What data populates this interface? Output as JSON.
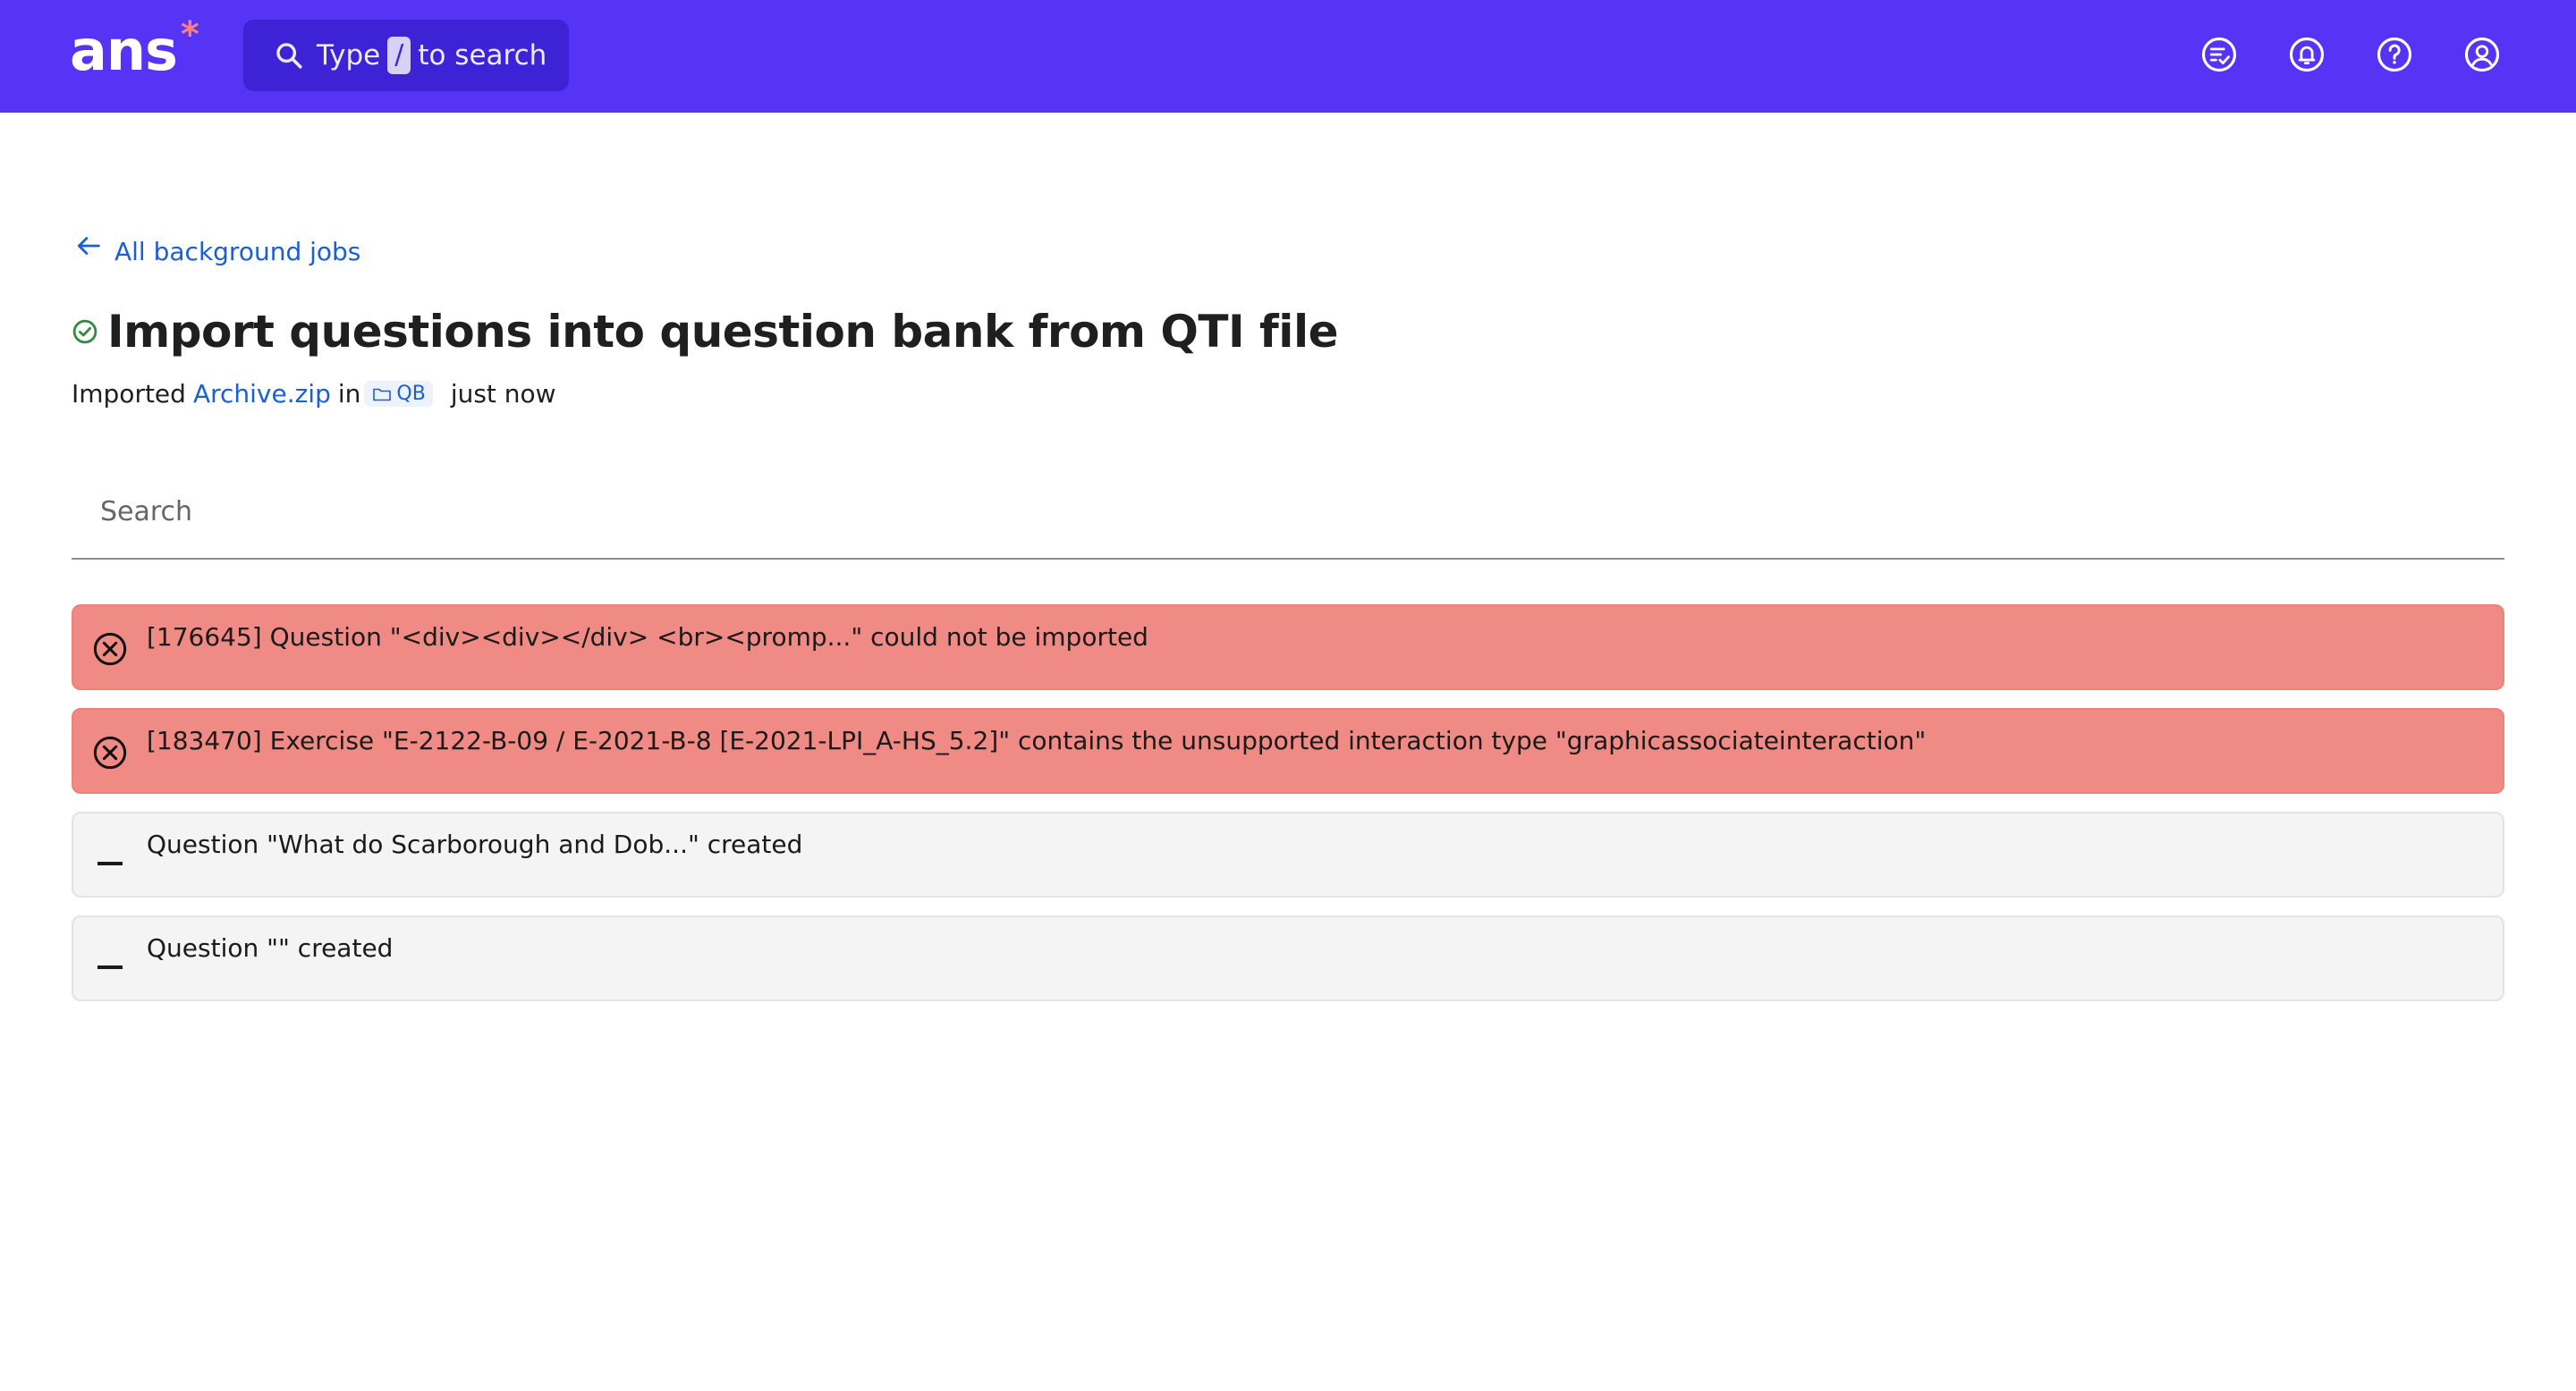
{
  "header": {
    "logo_text": "ans",
    "logo_mark": "*",
    "search_prefix": "Type",
    "search_key": "/",
    "search_suffix": "to search",
    "icons": [
      "tasks-icon",
      "notifications-icon",
      "help-icon",
      "account-icon"
    ],
    "brand_color": "#5534f6"
  },
  "nav": {
    "back_label": "All background jobs"
  },
  "page": {
    "title": "Import questions into question bank from QTI file",
    "status": "success",
    "imported_label": "Imported",
    "file_name": "Archive.zip",
    "in_label": "in",
    "folder_name": "QB",
    "time": "just now"
  },
  "search": {
    "placeholder": "Search",
    "value": ""
  },
  "results": [
    {
      "type": "error",
      "icon": "error-circle-icon",
      "message": "[176645] Question \"<div><div></div> <br><promp...\" could not be imported"
    },
    {
      "type": "error",
      "icon": "error-circle-icon",
      "message": "[183470] Exercise \"E-2122-B-09 / E-2021-B-8 [E-2021-LPI_A-HS_5.2]\" contains the unsupported interaction type \"graphicassociateinteraction\""
    },
    {
      "type": "ok",
      "icon": "dash-icon",
      "message": "Question \"What do Scarborough and Dob...\" created"
    },
    {
      "type": "ok",
      "icon": "dash-icon",
      "message": "Question \"\" created"
    }
  ]
}
